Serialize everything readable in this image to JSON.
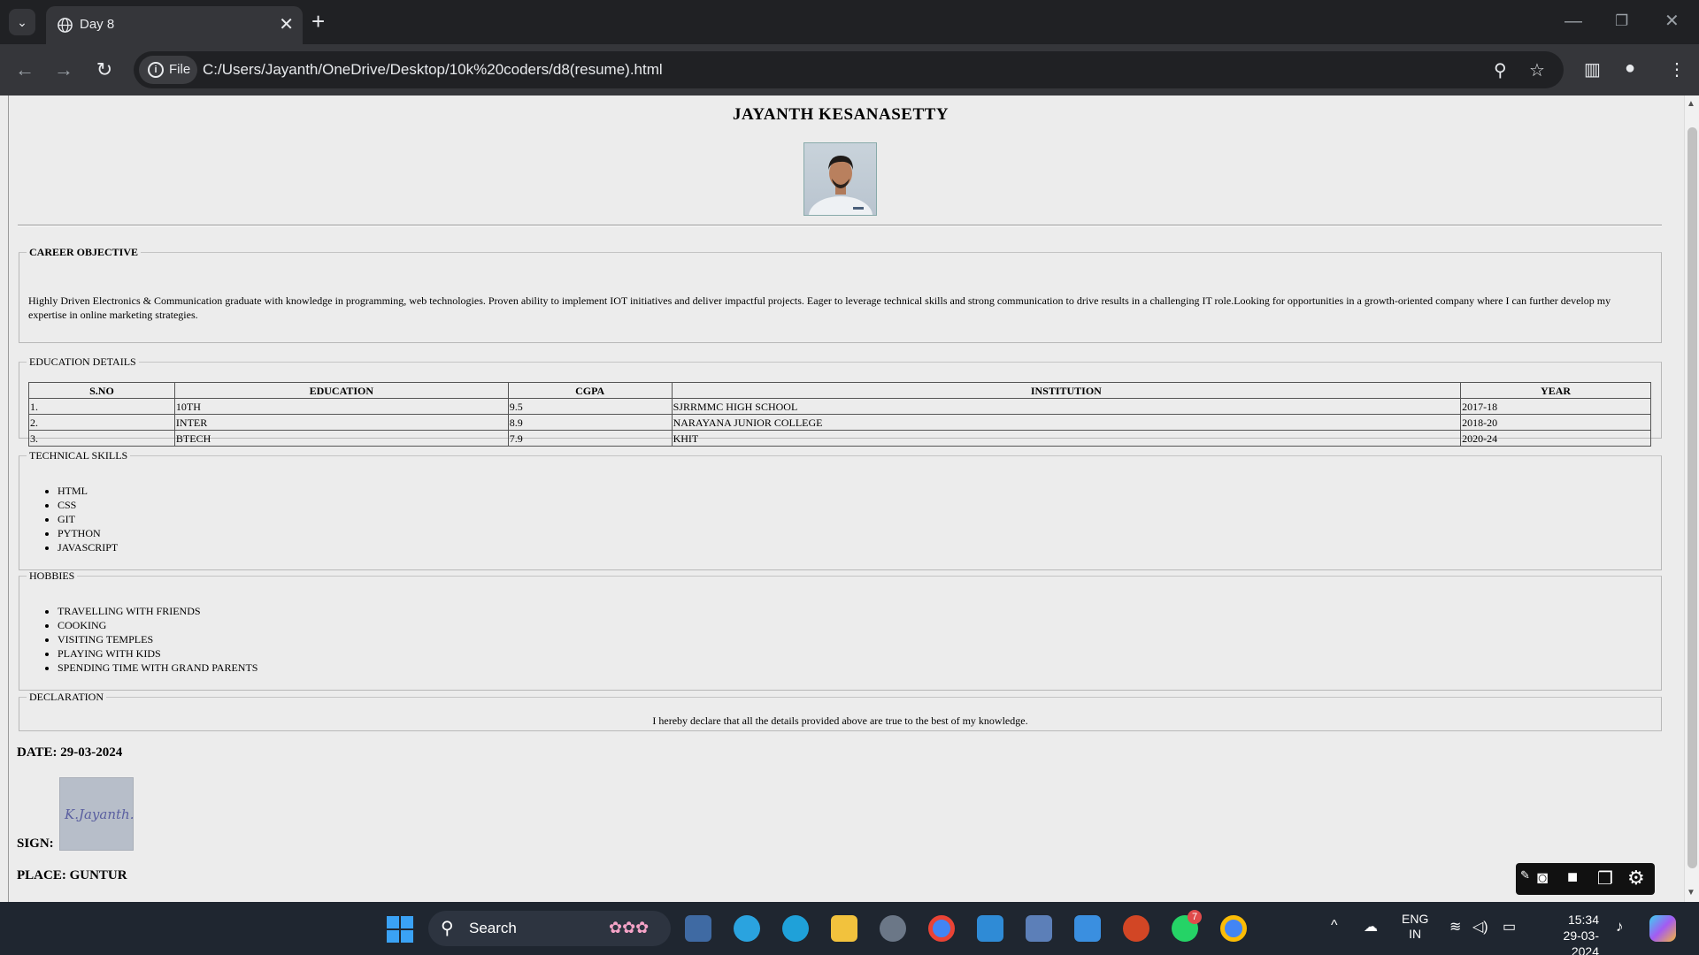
{
  "browser": {
    "tab_title": "Day 8",
    "tab_close": "✕",
    "new_tab": "+",
    "site_chip": "File",
    "url": "C:/Users/Jayanth/OneDrive/Desktop/10k%20coders/d8(resume).html"
  },
  "resume": {
    "name": "JAYANTH KESANASETTY",
    "objective": {
      "legend": "CAREER OBJECTIVE",
      "text": "Highly Driven Electronics & Communication graduate with knowledge in programming, web technologies. Proven ability to implement IOT initiatives and deliver impactful projects. Eager to leverage technical skills and strong communication to drive results in a challenging IT role.Looking for opportunities in a growth-oriented company where I can further develop my expertise in online marketing strategies."
    },
    "education": {
      "legend": "EDUCATION DETAILS",
      "headers": [
        "S.NO",
        "EDUCATION",
        "CGPA",
        "INSTITUTION",
        "YEAR"
      ],
      "rows": [
        [
          "1.",
          "10TH",
          "9.5",
          "SJRRMMC HIGH SCHOOL",
          "2017-18"
        ],
        [
          "2.",
          "INTER",
          "8.9",
          "NARAYANA JUNIOR COLLEGE",
          "2018-20"
        ],
        [
          "3.",
          "BTECH",
          "7.9",
          "KHIT",
          "2020-24"
        ]
      ]
    },
    "skills": {
      "legend": "TECHNICAL SKILLS",
      "items": [
        "HTML",
        "CSS",
        "GIT",
        "PYTHON",
        "JAVASCRIPT"
      ]
    },
    "hobbies": {
      "legend": "HOBBIES",
      "items": [
        "TRAVELLING WITH FRIENDS",
        "COOKING",
        "VISITING TEMPLES",
        "PLAYING WITH KIDS",
        "SPENDING TIME WITH GRAND PARENTS"
      ]
    },
    "declaration": {
      "legend": "DECLARATION",
      "text": "I hereby declare that all the details provided above are true to the best of my knowledge."
    },
    "date": "DATE: 29-03-2024",
    "sign_label": "SIGN:",
    "sign_text": "K.Jayanth.",
    "place": "PLACE: GUNTUR"
  },
  "taskbar": {
    "search_label": "Search",
    "lang_top": "ENG",
    "lang_bottom": "IN",
    "time": "15:34",
    "date": "29-03-2024",
    "whatsapp_badge": "7"
  },
  "colors": {
    "chrome_dark": "#202124",
    "chrome_toolbar": "#35363a",
    "page_bg": "#ececec",
    "taskbar_bg": "#1f2630"
  }
}
